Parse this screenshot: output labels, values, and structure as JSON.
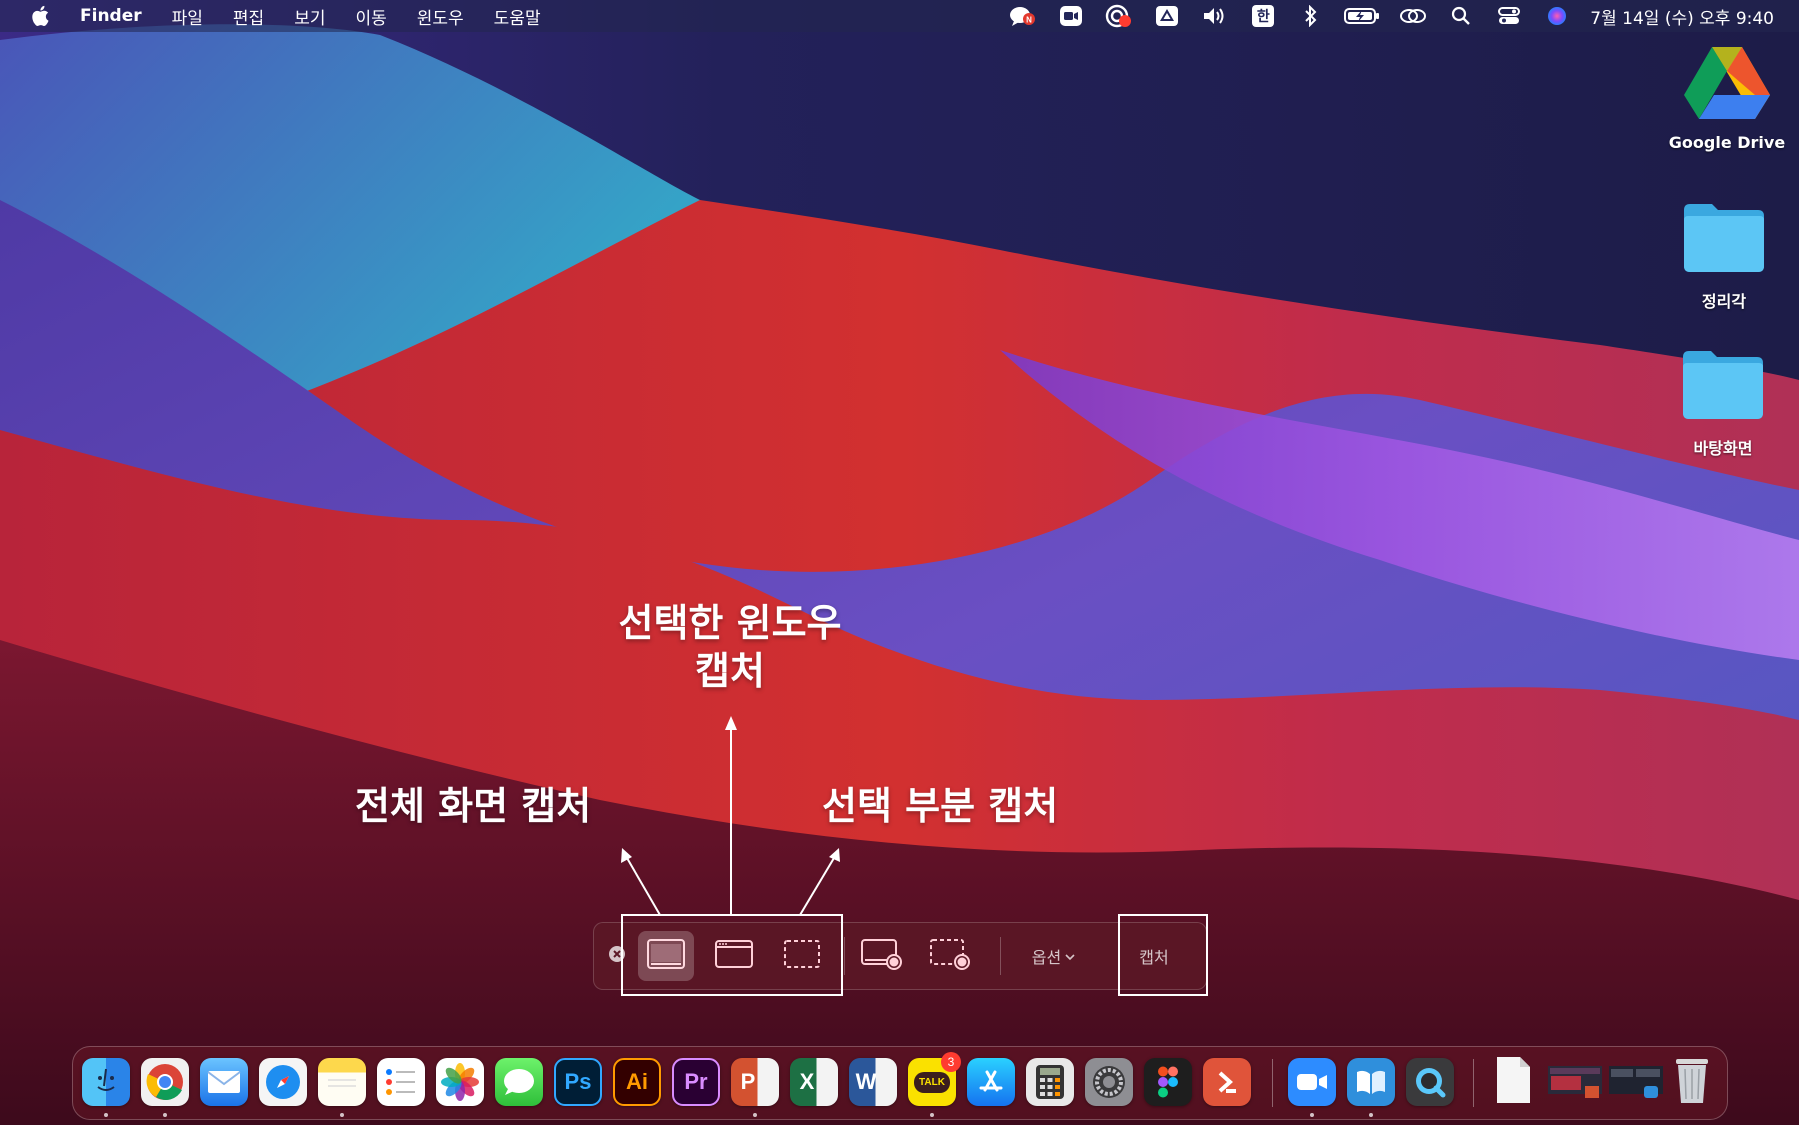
{
  "menubar": {
    "app_name": "Finder",
    "menus": [
      "파일",
      "편집",
      "보기",
      "이동",
      "윈도우",
      "도움말"
    ],
    "input_source": "한",
    "clock": "7월 14일 (수) 오후 9:40",
    "status_icons": [
      "naver-talk-icon",
      "zoom-icon",
      "recording-icon",
      "google-drive-icon",
      "volume-icon",
      "input-source-icon",
      "bluetooth-icon",
      "battery-icon",
      "airplay-icon",
      "spotlight-icon",
      "control-center-icon",
      "siri-icon"
    ]
  },
  "desktop": {
    "items": [
      {
        "label": "Google Drive",
        "icon": "google-drive-icon"
      },
      {
        "label": "정리각",
        "icon": "folder-icon"
      },
      {
        "label": "바탕화면",
        "icon": "folder-icon"
      }
    ]
  },
  "annotations": {
    "window_capture_line1": "선택한 윈도우",
    "window_capture_line2": "캡처",
    "full_screen": "전체 화면 캡처",
    "selection": "선택 부분 캡처"
  },
  "capture_toolbar": {
    "options_label": "옵션",
    "capture_label": "캡처",
    "buttons": [
      "close-icon",
      "capture-entire-screen-icon",
      "capture-window-icon",
      "capture-selection-icon",
      "record-entire-screen-icon",
      "record-selection-icon"
    ]
  },
  "dock": {
    "apps": [
      "Finder",
      "Chrome",
      "Mail",
      "Safari",
      "Notes",
      "Reminders",
      "Photos",
      "Messages",
      "Photoshop",
      "Illustrator",
      "Premiere Pro",
      "PowerPoint",
      "Excel",
      "Word",
      "KakaoTalk",
      "App Store",
      "Calculator",
      "System Preferences",
      "Figma",
      "Remote Desktop",
      "Zoom",
      "Naver Dictionary",
      "QuickTime Player",
      "Document",
      "Recent Screenshot",
      "Recent Window",
      "Trash"
    ],
    "tile_text": {
      "photoshop": "Ps",
      "illustrator": "Ai",
      "premiere": "Pr",
      "powerpoint": "P",
      "excel": "X",
      "word": "W",
      "kakaotalk": "TALK"
    },
    "kakaotalk_badge": "3"
  }
}
